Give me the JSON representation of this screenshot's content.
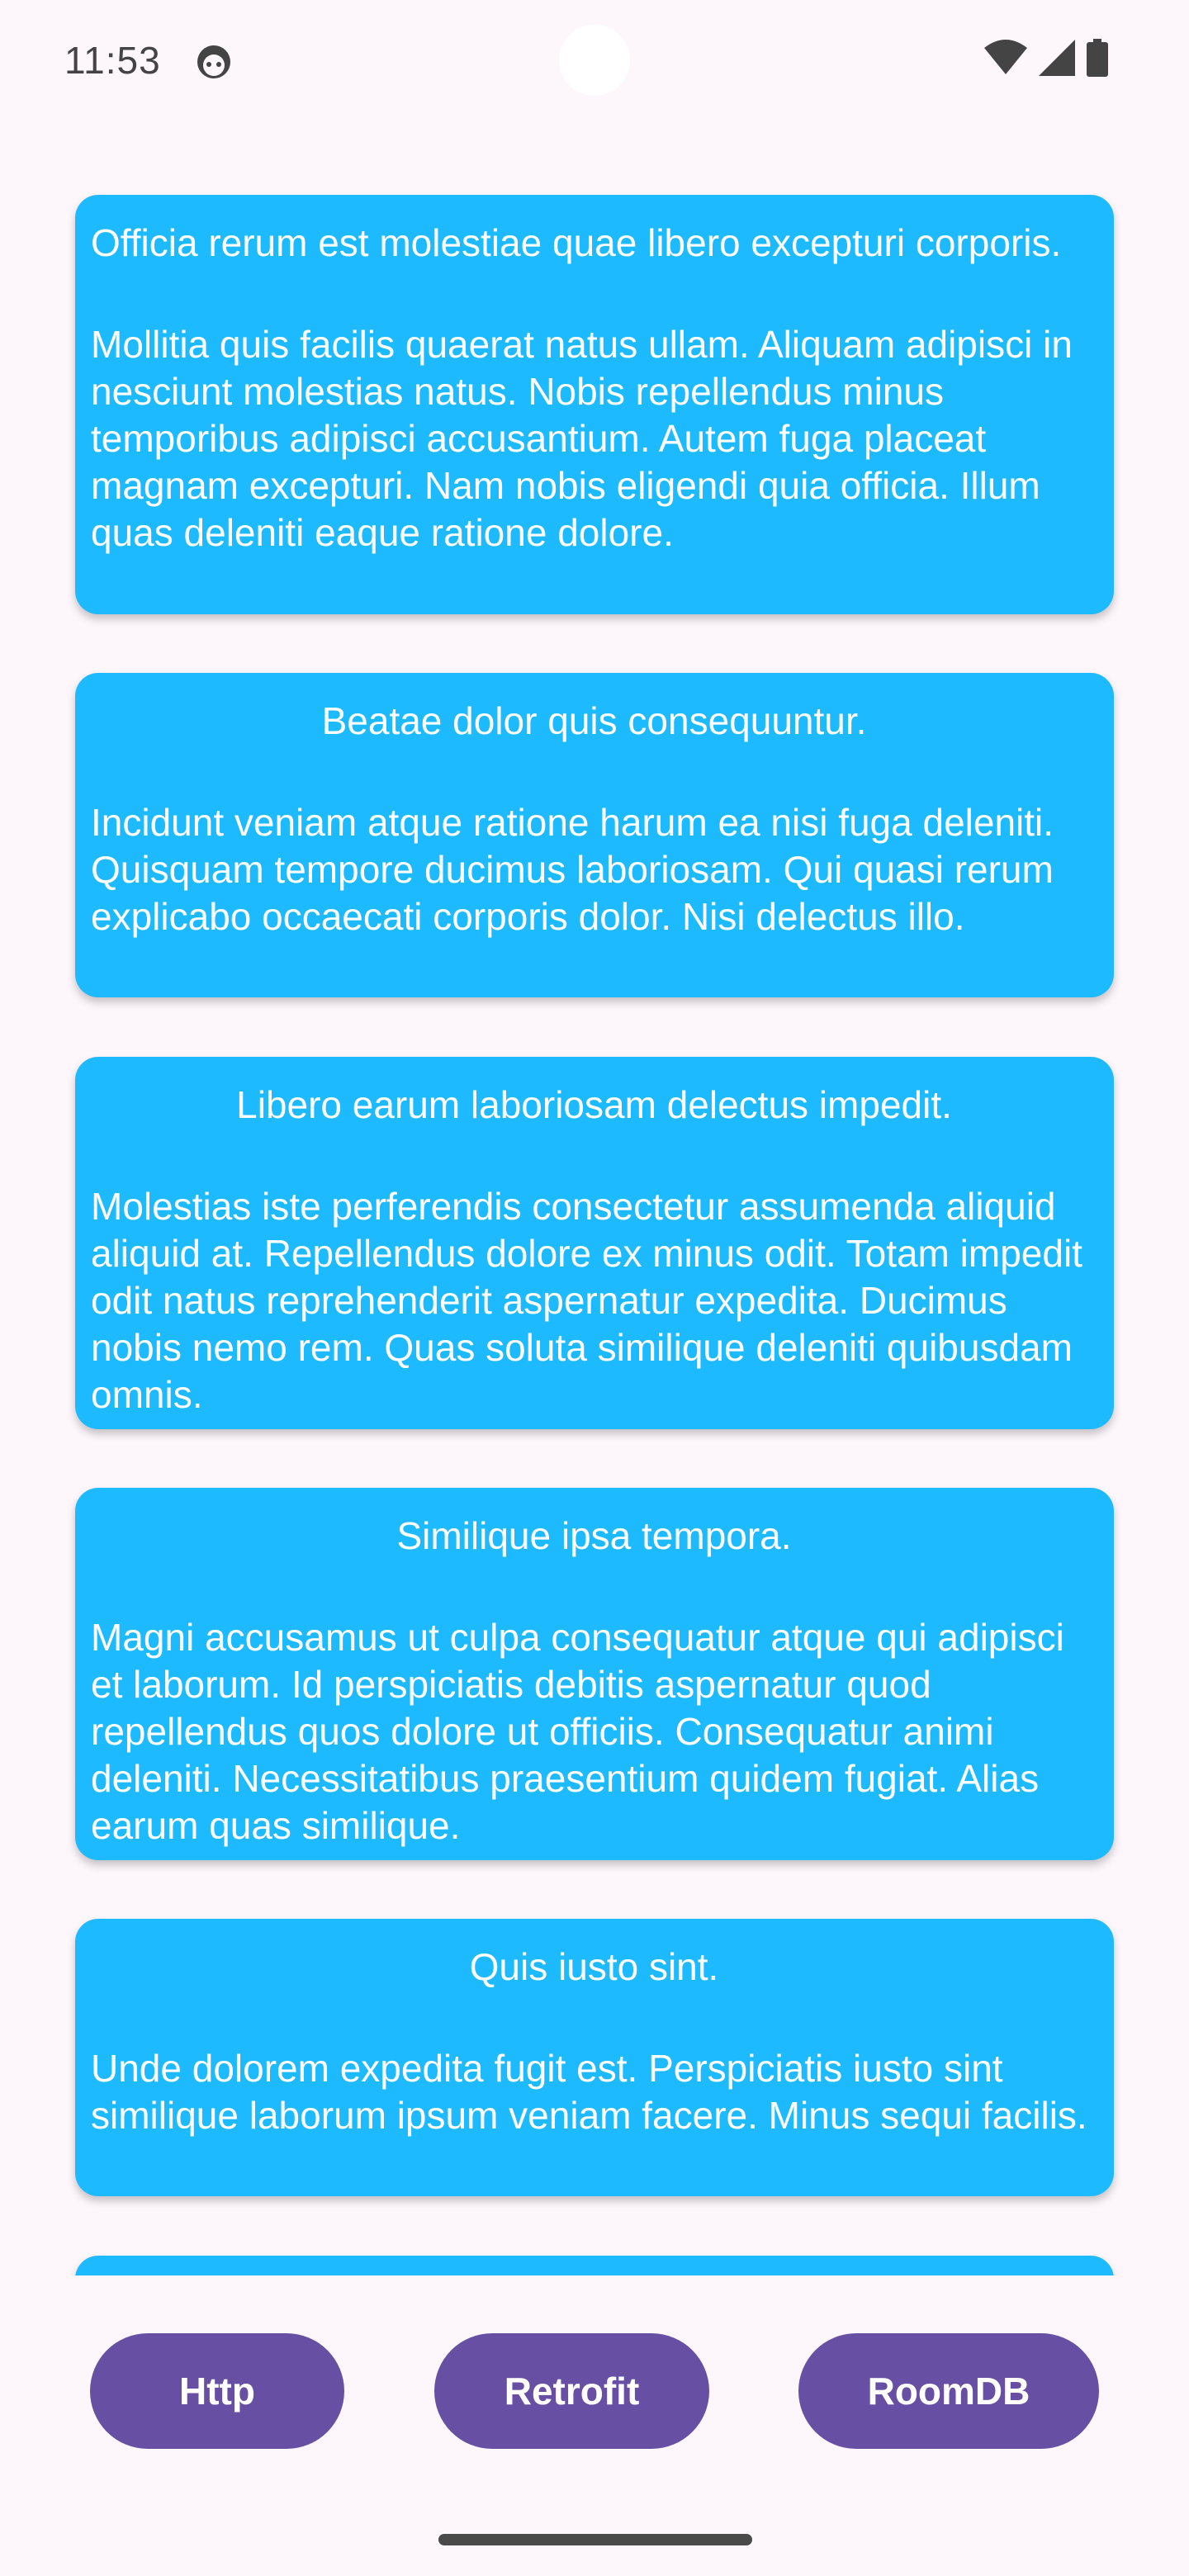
{
  "status_bar": {
    "time": "11:53",
    "notification_icon": "android-face-icon",
    "icons": [
      "wifi-icon",
      "cellular-signal-icon",
      "battery-icon"
    ]
  },
  "colors": {
    "card_background": "#1dbaff",
    "button_background": "#6750a4",
    "page_background": "#fdf7fc"
  },
  "cards": [
    {
      "title": "Officia rerum est molestiae quae libero excepturi corporis.",
      "title_align": "left",
      "body": "Mollitia quis facilis quaerat natus ullam. Aliquam adipisci in nesciunt molestias natus. Nobis repellendus minus temporibus adipisci accusantium. Autem fuga placeat magnam excepturi. Nam nobis eligendi quia officia. Illum quas deleniti eaque ratione dolore."
    },
    {
      "title": "Beatae dolor quis consequuntur.",
      "title_align": "center",
      "body": "Incidunt veniam atque ratione harum ea nisi fuga deleniti. Quisquam tempore ducimus laboriosam. Qui quasi rerum explicabo occaecati corporis dolor. Nisi delectus illo."
    },
    {
      "title": "Libero earum laboriosam delectus impedit.",
      "title_align": "center",
      "body": "Molestias iste perferendis consectetur assumenda aliquid aliquid at. Repellendus dolore ex minus odit. Totam impedit odit natus reprehenderit aspernatur expedita. Ducimus nobis nemo rem. Quas soluta similique deleniti quibusdam omnis."
    },
    {
      "title": "Similique ipsa tempora.",
      "title_align": "center",
      "body": "Magni accusamus ut culpa consequatur atque qui adipisci et laborum. Id perspiciatis debitis aspernatur quod repellendus quos dolore ut officiis. Consequatur animi deleniti. Necessitatibus praesentium quidem fugiat. Alias earum quas similique."
    },
    {
      "title": "Quis iusto sint.",
      "title_align": "center",
      "body": "Unde dolorem expedita fugit est. Perspiciatis iusto sint similique laborum ipsum veniam facere. Minus sequi facilis."
    },
    {
      "title": "",
      "title_align": "center",
      "body": ""
    }
  ],
  "buttons": {
    "http": "Http",
    "retrofit": "Retrofit",
    "roomdb": "RoomDB"
  }
}
